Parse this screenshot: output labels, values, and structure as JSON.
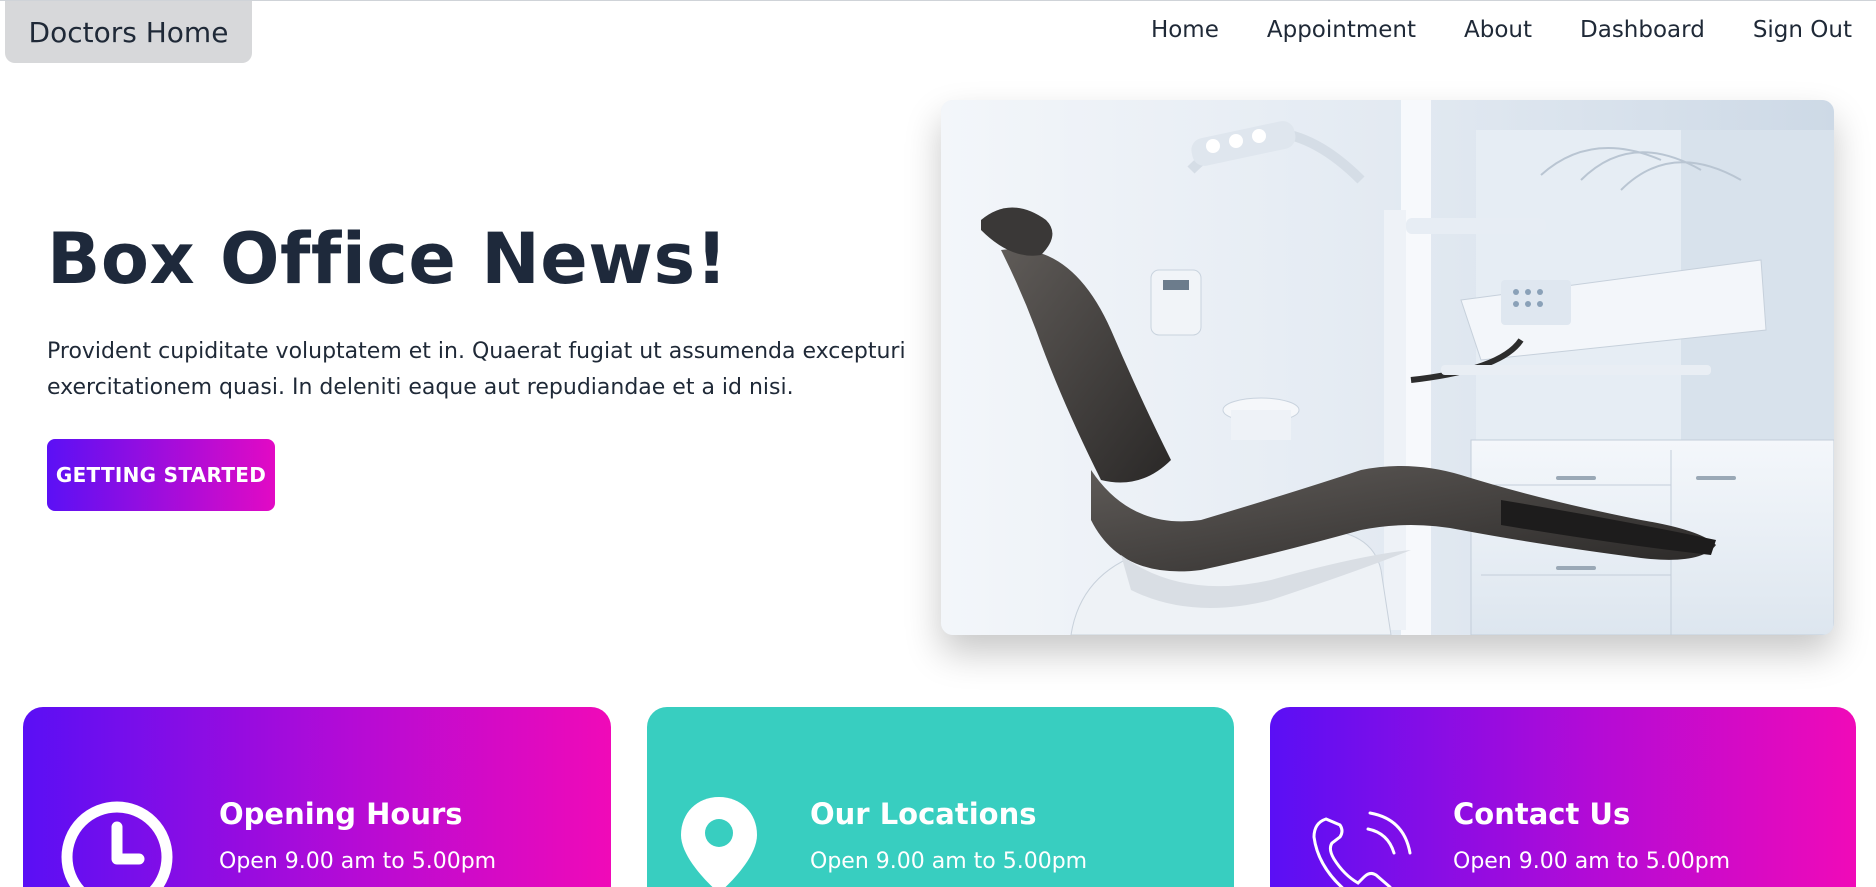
{
  "header": {
    "brand": "Doctors Home",
    "nav": [
      "Home",
      "Appointment",
      "About",
      "Dashboard",
      "Sign Out"
    ]
  },
  "hero": {
    "title": "Box Office News!",
    "text": "Provident cupiditate voluptatem et in. Quaerat fugiat ut assumenda excepturi exercitationem quasi. In deleniti eaque aut repudiandae et a id nisi.",
    "button": "GETTING STARTED"
  },
  "cards": [
    {
      "title": "Opening Hours",
      "text": "Open 9.00 am to 5.00pm",
      "icon": "clock-icon"
    },
    {
      "title": "Our Locations",
      "text": "Open 9.00 am to 5.00pm",
      "icon": "map-pin-icon"
    },
    {
      "title": "Contact Us",
      "text": "Open 9.00 am to 5.00pm",
      "icon": "phone-icon"
    }
  ],
  "colors": {
    "gradient_start": "#5a0ff5",
    "gradient_end": "#f00ab8",
    "teal": "#38cec0",
    "heading": "#1e293b"
  }
}
